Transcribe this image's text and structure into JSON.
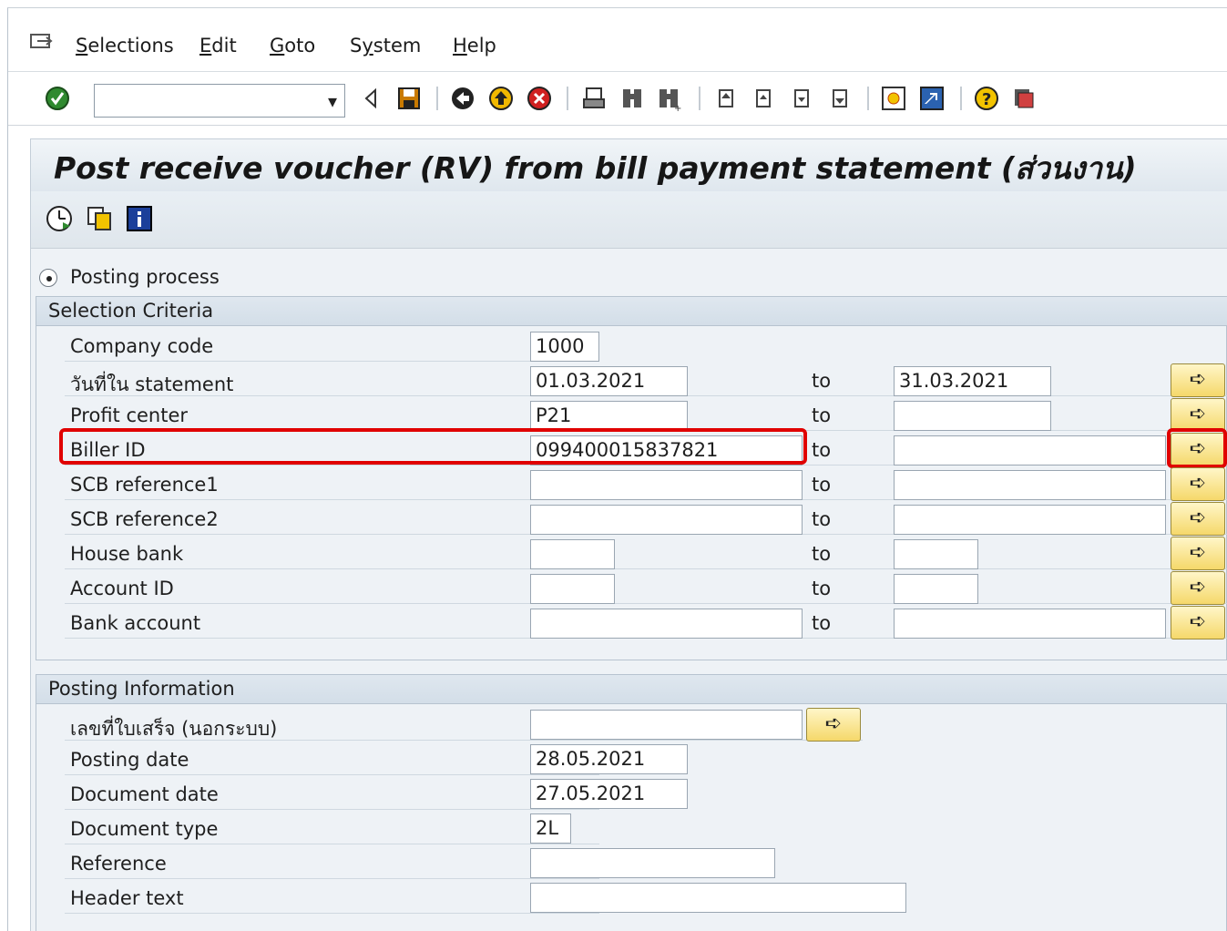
{
  "menu": {
    "items": [
      "Selections",
      "Edit",
      "Goto",
      "System",
      "Help"
    ],
    "mnemonics": [
      "S",
      "E",
      "G",
      "y",
      "H"
    ]
  },
  "toolbar": {
    "command_field_value": "",
    "icons": [
      "enter-icon",
      "back-icon",
      "save-icon",
      "back-green-icon",
      "exit-icon",
      "cancel-icon",
      "print-icon",
      "find-icon",
      "find-next-icon",
      "first-page-icon",
      "previous-page-icon",
      "next-page-icon",
      "last-page-icon",
      "create-session-icon",
      "shortcut-icon",
      "help-icon",
      "customize-layout-icon"
    ]
  },
  "title": "Post receive voucher (RV) from bill payment statement (ส่วนงาน)",
  "app_toolbar": {
    "icons": [
      "execute-icon",
      "get-variant-icon",
      "information-icon"
    ]
  },
  "radio": {
    "label": "Posting process",
    "selected": true
  },
  "selection_criteria": {
    "header": "Selection Criteria",
    "to_label": "to",
    "rows": [
      {
        "label": "Company code",
        "from": "1000",
        "to": null
      },
      {
        "label": "วันที่ใน statement",
        "from": "01.03.2021",
        "to": "31.03.2021"
      },
      {
        "label": "Profit center",
        "from": "P21",
        "to": ""
      },
      {
        "label": "Biller ID",
        "from": "099400015837821",
        "to": ""
      },
      {
        "label": "SCB reference1",
        "from": "",
        "to": ""
      },
      {
        "label": "SCB reference2",
        "from": "",
        "to": ""
      },
      {
        "label": "House bank",
        "from": "",
        "to": ""
      },
      {
        "label": "Account ID",
        "from": "",
        "to": ""
      },
      {
        "label": "Bank account",
        "from": "",
        "to": ""
      }
    ]
  },
  "posting_information": {
    "header": "Posting Information",
    "rows": [
      {
        "label": "เลขที่ใบเสร็จ (นอกระบบ)",
        "value": ""
      },
      {
        "label": "Posting date",
        "value": "28.05.2021"
      },
      {
        "label": "Document date",
        "value": "27.05.2021"
      },
      {
        "label": "Document type",
        "value": "2L"
      },
      {
        "label": "Reference",
        "value": ""
      },
      {
        "label": "Header text",
        "value": ""
      }
    ]
  },
  "colors": {
    "highlight": "#e00000",
    "multi_button": "#f5d86a",
    "group_header": "#d3dee8"
  }
}
